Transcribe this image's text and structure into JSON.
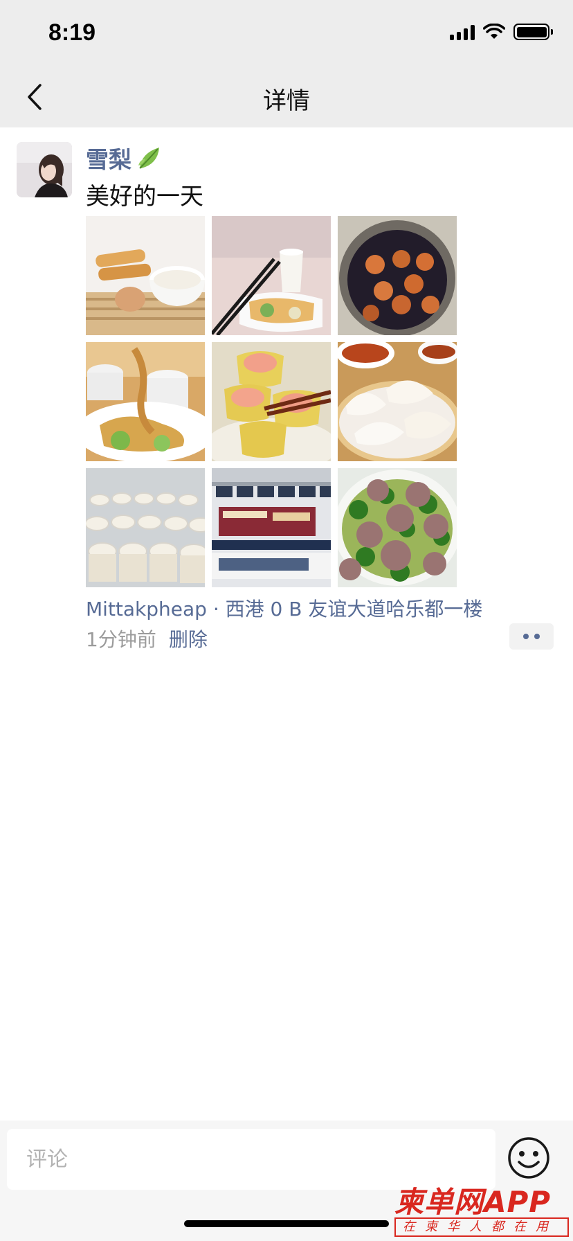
{
  "status_bar": {
    "time": "8:19"
  },
  "nav": {
    "title": "详情"
  },
  "post": {
    "author": "雪梨",
    "text": "美好的一天",
    "photos": [
      "fried-dough-soymilk-egg",
      "soymilk-chopsticks-plate",
      "tea-eggs-pot",
      "noodles-soup-cups",
      "shrimp-shumai",
      "har-gow-dumplings",
      "dessert-cups",
      "restaurant-storefront",
      "meatball-soup"
    ],
    "location": "Mittakpheap · 西港 0 B 友谊大道哈乐都一楼",
    "time_ago": "1分钟前",
    "delete_label": "删除"
  },
  "comment": {
    "placeholder": "评论"
  },
  "watermark": {
    "brand": "柬单网APP",
    "slogan": "在柬华人都在用"
  },
  "colors": {
    "link": "#576b95",
    "nav_bg": "#ededed",
    "watermark": "#d9271f"
  }
}
